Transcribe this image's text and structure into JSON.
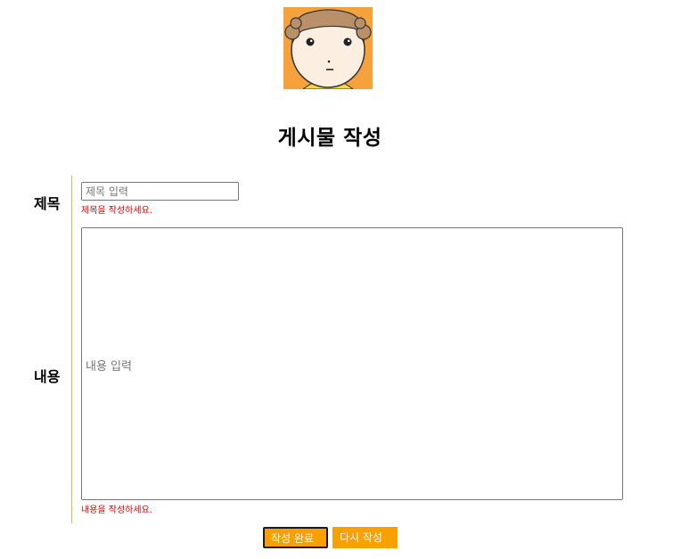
{
  "page": {
    "title": "게시물 작성"
  },
  "logo": {
    "icon": "character-face-avatar",
    "background": "#f5a23c"
  },
  "form": {
    "title_label": "제목",
    "title_placeholder": "제목 입력",
    "title_value": "",
    "title_error": "제목을 작성하세요.",
    "content_label": "내용",
    "content_placeholder": "내용 입력",
    "content_value": "",
    "content_error": "내용을 작성하세요."
  },
  "buttons": {
    "submit_label": "작성 완료",
    "reset_label": "다시 작성"
  },
  "colors": {
    "accent": "#f7a000",
    "error": "#d40000",
    "divider": "#e8b652"
  }
}
